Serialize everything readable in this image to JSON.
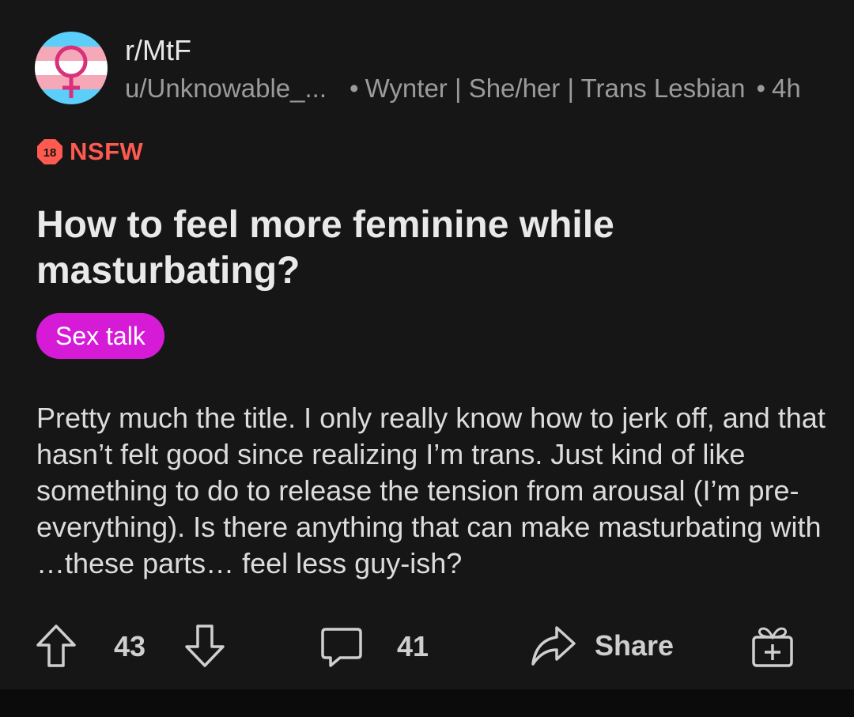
{
  "header": {
    "subreddit": "r/MtF",
    "username": "u/Unknowable_...",
    "separator": "•",
    "user_flair": "Wynter | She/her | Trans Lesbian",
    "time_ago": "4h",
    "avatar_icon": "trans-flag-venus-icon"
  },
  "nsfw": {
    "badge_text": "18",
    "label": "NSFW",
    "color": "#ff5a4f"
  },
  "post": {
    "title": "How to feel more feminine while masturbating?",
    "flair": "Sex talk",
    "flair_color": "#d61bd6",
    "body": "Pretty much the title. I only really know how to jerk off, and that hasn’t felt good since realizing I’m trans. Just kind of like something to do to release the tension from arousal (I’m pre-everything). Is there anything that can make masturbating with …these parts… feel less guy-ish?"
  },
  "actions": {
    "upvote_icon": "arrow-up-icon",
    "score": "43",
    "downvote_icon": "arrow-down-icon",
    "comment_icon": "comment-bubble-icon",
    "comments": "41",
    "share_icon": "share-arrow-icon",
    "share_label": "Share",
    "award_icon": "gift-award-icon"
  }
}
